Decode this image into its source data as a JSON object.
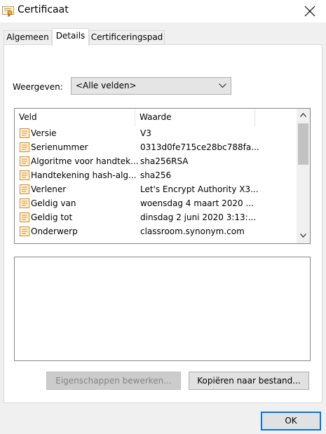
{
  "window": {
    "title": "Certificaat",
    "icon": "certificate-icon",
    "close_icon": "close-icon"
  },
  "tabs": [
    {
      "label": "Algemeen",
      "active": false
    },
    {
      "label": "Details",
      "active": true
    },
    {
      "label": "Certificeringspad",
      "active": false
    }
  ],
  "show": {
    "label": "Weergeven:",
    "selected": "<Alle velden>"
  },
  "listview": {
    "columns": [
      "Veld",
      "Waarde"
    ],
    "rows": [
      {
        "field": "Versie",
        "value": "V3"
      },
      {
        "field": "Serienummer",
        "value": "0313d0fe715ce28bc788fa..."
      },
      {
        "field": "Algoritme voor handtek...",
        "value": "sha256RSA"
      },
      {
        "field": "Handtekening hash-alg...",
        "value": "sha256"
      },
      {
        "field": "Verlener",
        "value": "Let's Encrypt Authority X3..."
      },
      {
        "field": "Geldig van",
        "value": "woensdag 4 maart 2020 ..."
      },
      {
        "field": "Geldig tot",
        "value": "dinsdag 2 juni 2020 3:13:..."
      },
      {
        "field": "Onderwerp",
        "value": "classroom.synonym.com"
      }
    ]
  },
  "buttons": {
    "edit_properties": "Eigenschappen bewerken...",
    "copy_to_file": "Kopiëren naar bestand...",
    "ok": "OK"
  },
  "colors": {
    "dialog_bg": "#f0f0f0",
    "accent_focus": "#0078d7",
    "disabled_text": "#838383"
  }
}
